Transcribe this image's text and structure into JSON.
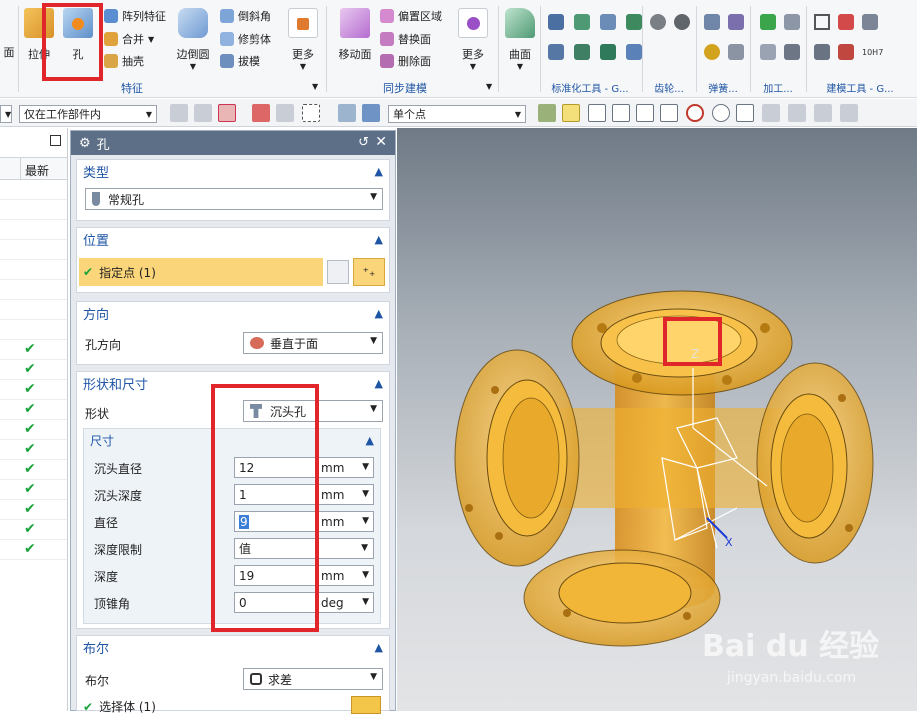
{
  "ribbon": {
    "cut_left_label": "面",
    "extrude_label": "拉伸",
    "hole_label": "孔",
    "pattern_feature": "阵列特征",
    "unite": "合并",
    "shell": "抽壳",
    "edge_blend": "边倒圆",
    "chamfer": "倒斜角",
    "trim_body": "修剪体",
    "draft": "拔模",
    "more": "更多",
    "feature_group": "特征",
    "move_face": "移动面",
    "offset_region": "偏置区域",
    "replace_face": "替换面",
    "delete_face": "删除面",
    "more2": "更多",
    "sync_group": "同步建模",
    "surface": "曲面",
    "std_tools_group": "标准化工具 - G...",
    "gear_group": "齿轮...",
    "spring_group": "弹簧...",
    "machining_group": "加工...",
    "modeling_tools_group": "建模工具 - G...",
    "tolerance_badge": "10H7"
  },
  "toolbar2": {
    "filter_value": "仅在工作部件内",
    "snap_value": "单个点"
  },
  "navigator": {
    "header_latest": "最新",
    "checks": [
      "✔",
      "✔",
      "✔",
      "✔",
      "✔",
      "✔",
      "✔",
      "✔",
      "✔",
      "✔",
      "✔"
    ]
  },
  "dialog": {
    "title": "孔",
    "type_section": "类型",
    "type_value": "常规孔",
    "position_section": "位置",
    "specify_point": "指定点 (1)",
    "direction_section": "方向",
    "hole_direction_label": "孔方向",
    "hole_direction_value": "垂直于面",
    "shape_section": "形状和尺寸",
    "shape_label": "形状",
    "shape_value": "沉头孔",
    "dims_section": "尺寸",
    "fields": [
      {
        "label": "沉头直径",
        "value": "12",
        "unit": "mm"
      },
      {
        "label": "沉头深度",
        "value": "1",
        "unit": "mm"
      },
      {
        "label": "直径",
        "value": "9",
        "unit": "mm"
      },
      {
        "label": "深度限制",
        "value": "值",
        "unit": ""
      },
      {
        "label": "深度",
        "value": "19",
        "unit": "mm"
      },
      {
        "label": "顶锥角",
        "value": "0",
        "unit": "deg"
      }
    ],
    "boolean_section": "布尔",
    "boolean_label": "布尔",
    "boolean_value": "求差",
    "select_body": "选择体 (1)"
  },
  "viewport": {
    "axis_z": "Z",
    "axis_x": "X",
    "watermark_brand": "Bai du 经验",
    "watermark_url": "jingyan.baidu.com",
    "part_color": "#f0b429"
  }
}
